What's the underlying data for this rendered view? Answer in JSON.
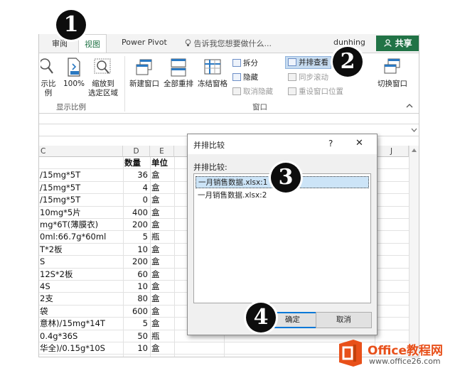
{
  "tabs": {
    "review": "审阅",
    "view": "视图",
    "power_pivot": "Power Pivot",
    "tellme": "告诉我您想要做什么...",
    "user": "dunhing",
    "share": "共享"
  },
  "ribbon": {
    "ratio": "示比例",
    "hundred": "100%",
    "zoom_selection_1": "缩放到",
    "zoom_selection_2": "选定区域",
    "zoom_group": "显示比例",
    "new_window": "新建窗口",
    "arrange_all": "全部重排",
    "freeze_panes": "冻结窗格",
    "split": "拆分",
    "hide": "隐藏",
    "unhide": "取消隐藏",
    "view_side_by_side": "并排查看",
    "sync_scroll": "同步滚动",
    "reset_position": "重设窗口位置",
    "switch_windows": "切换窗口",
    "window_group": "窗口"
  },
  "sheet": {
    "col_c": "C",
    "col_d": "D",
    "col_e": "E",
    "col_j": "J",
    "header_qty": "数量",
    "header_unit": "单位",
    "rows": [
      {
        "c": "/15mg*5T",
        "d": "36",
        "e": "盒"
      },
      {
        "c": "/15mg*5T",
        "d": "4",
        "e": "盒"
      },
      {
        "c": "/15mg*5T",
        "d": "0",
        "e": "盒"
      },
      {
        "c": "10mg*5片",
        "d": "400",
        "e": "盒"
      },
      {
        "c": "mg*6T(薄膜衣)",
        "d": "200",
        "e": "盒"
      },
      {
        "c": "0ml:66.7g*60ml",
        "d": "5",
        "e": "瓶"
      },
      {
        "c": "T*2板",
        "d": "10",
        "e": "盒"
      },
      {
        "c": "S",
        "d": "200",
        "e": "盒"
      },
      {
        "c": "12S*2板",
        "d": "60",
        "e": "盒"
      },
      {
        "c": "4S",
        "d": "10",
        "e": "盒"
      },
      {
        "c": "2支",
        "d": "80",
        "e": "盒"
      },
      {
        "c": "袋",
        "d": "600",
        "e": "盒"
      },
      {
        "c": "意林)/15mg*14T",
        "d": "5",
        "e": "盒"
      },
      {
        "c": "0.4g*36S",
        "d": "50",
        "e": "瓶"
      },
      {
        "c": "华全)/0.15g*10S",
        "d": "10",
        "e": "盒"
      }
    ]
  },
  "dialog": {
    "title": "并排比较",
    "help": "?",
    "close": "✕",
    "label": "并排比较:",
    "items": [
      "一月销售数据.xlsx:1",
      "一月销售数据.xlsx:2"
    ],
    "ok": "确定",
    "cancel": "取消"
  },
  "badges": [
    "1",
    "2",
    "3",
    "4"
  ],
  "watermark": {
    "brand": "Office教程网",
    "url": "www.office26.com"
  },
  "colors": {
    "excel_green": "#217346",
    "selection_blue": "#cce4f7",
    "logo_orange": "#e8501a"
  }
}
